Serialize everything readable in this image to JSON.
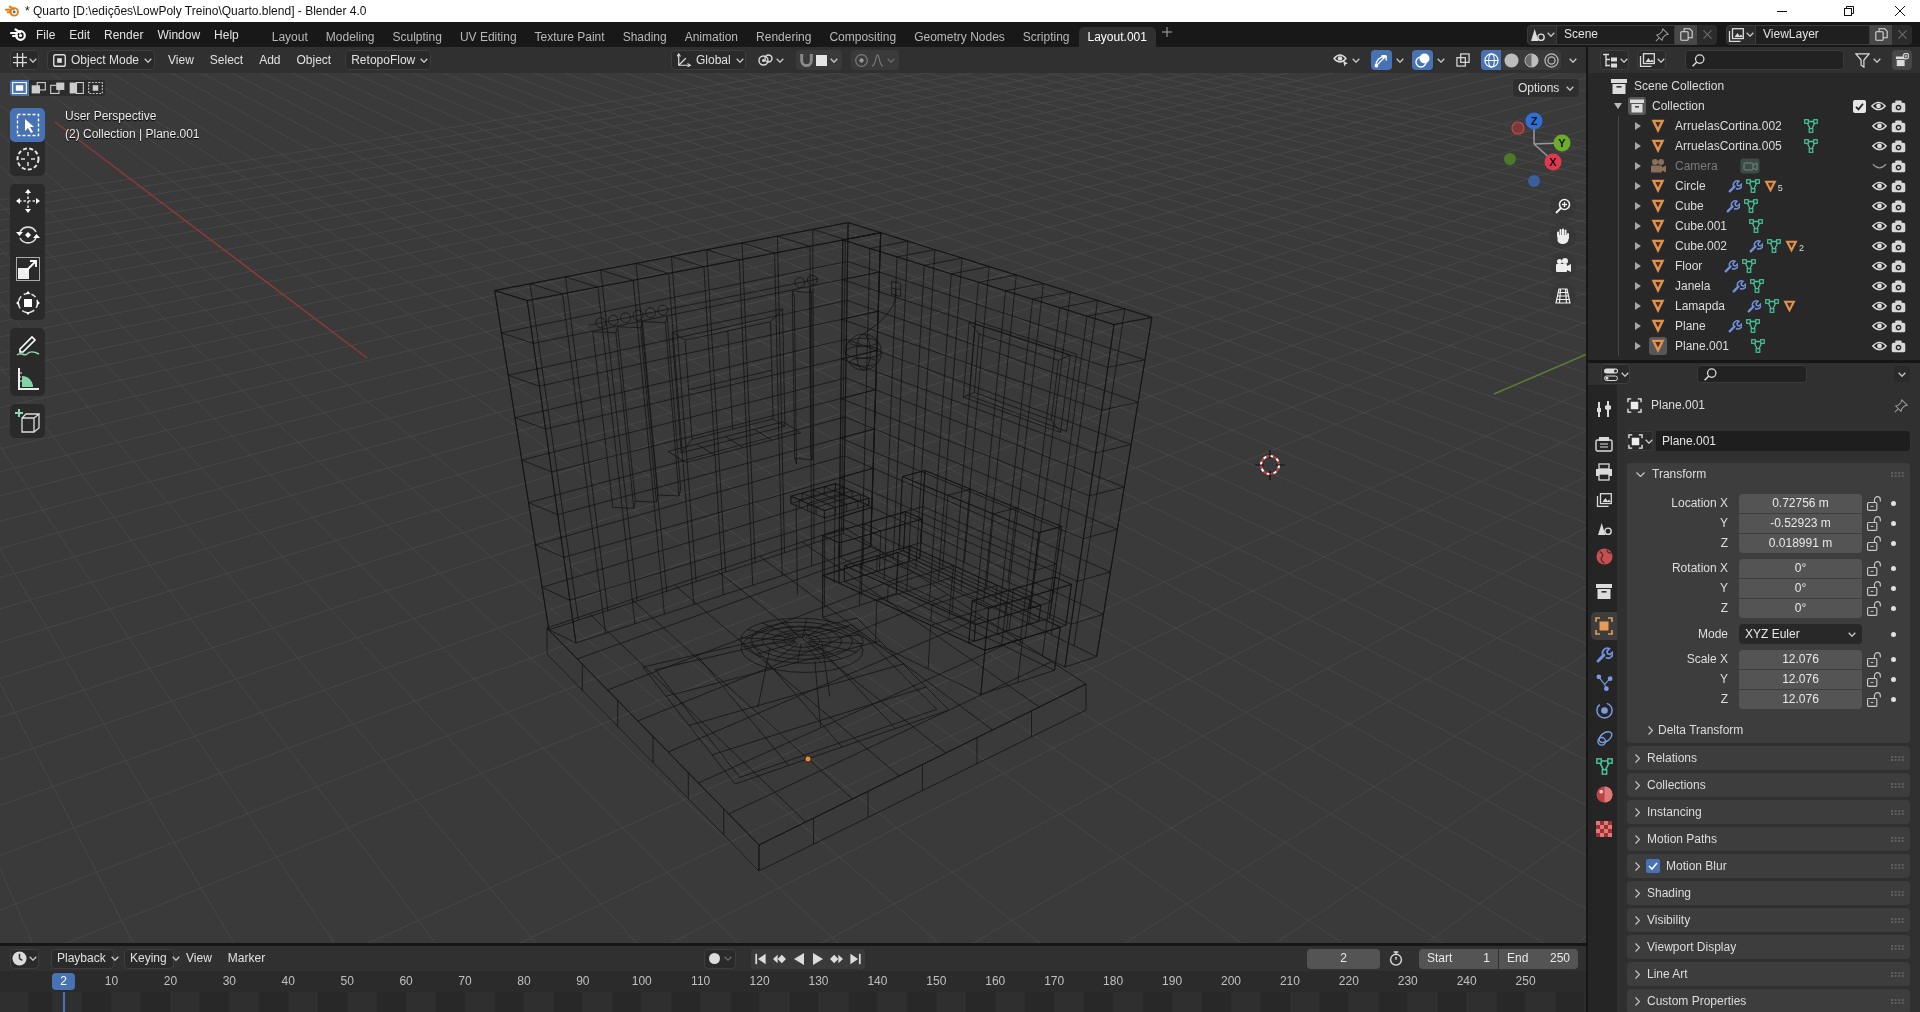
{
  "window": {
    "title": "* Quarto [D:\\edições\\LowPoly Treino\\Quarto.blend] - Blender 4.0"
  },
  "menu": [
    "File",
    "Edit",
    "Render",
    "Window",
    "Help"
  ],
  "workspaces": [
    {
      "label": "Layout",
      "selected": false
    },
    {
      "label": "Modeling",
      "selected": false
    },
    {
      "label": "Sculpting",
      "selected": false
    },
    {
      "label": "UV Editing",
      "selected": false
    },
    {
      "label": "Texture Paint",
      "selected": false
    },
    {
      "label": "Shading",
      "selected": false
    },
    {
      "label": "Animation",
      "selected": false
    },
    {
      "label": "Rendering",
      "selected": false
    },
    {
      "label": "Compositing",
      "selected": false
    },
    {
      "label": "Geometry Nodes",
      "selected": false
    },
    {
      "label": "Scripting",
      "selected": false
    },
    {
      "label": "Layout.001",
      "selected": true
    }
  ],
  "scene": {
    "name": "Scene"
  },
  "view_layer": {
    "name": "ViewLayer"
  },
  "viewport": {
    "mode": "Object Mode",
    "menus": [
      "View",
      "Select",
      "Add",
      "Object"
    ],
    "addon_menu": "RetopoFlow",
    "orientation": "Global",
    "gizmos_on": true,
    "overlays_on": true,
    "xray_on": false,
    "shading": [
      {
        "kind": "wireframe",
        "selected": true
      },
      {
        "kind": "solid",
        "selected": false
      },
      {
        "kind": "material",
        "selected": false
      },
      {
        "kind": "rendered",
        "selected": false
      }
    ],
    "select_modes": [
      {
        "kind": "set",
        "selected": true
      },
      {
        "kind": "extend",
        "selected": false
      },
      {
        "kind": "subtract",
        "selected": false
      },
      {
        "kind": "invert",
        "selected": false
      },
      {
        "kind": "intersect",
        "selected": false
      }
    ],
    "options": "Options",
    "info": [
      "User Perspective",
      "(2) Collection | Plane.001"
    ],
    "tool_groups": [
      [
        {
          "kind": "select_box",
          "selected": true
        },
        {
          "kind": "cursor",
          "selected": false
        }
      ],
      [
        {
          "kind": "move",
          "selected": false
        },
        {
          "kind": "rotate",
          "selected": false
        },
        {
          "kind": "scale",
          "selected": false
        },
        {
          "kind": "transform",
          "selected": false
        }
      ],
      [
        {
          "kind": "annotate",
          "selected": false
        },
        {
          "kind": "measure",
          "selected": false
        }
      ],
      [
        {
          "kind": "add_cube",
          "selected": false
        }
      ]
    ],
    "gizmo_axes": [
      "X",
      "Y",
      "Z"
    ]
  },
  "outliner": {
    "root": "Scene Collection",
    "collection": {
      "name": "Collection",
      "selected": true,
      "expanded": true,
      "checked": true,
      "visible": true,
      "children": [
        {
          "name": "ArruelasCortina.002",
          "kind": "mesh",
          "selected": false,
          "expanded": false,
          "visible": true,
          "badges": [
            {
              "kind": "mesh"
            }
          ]
        },
        {
          "name": "ArruelasCortina.005",
          "kind": "mesh",
          "selected": false,
          "expanded": false,
          "visible": true,
          "badges": [
            {
              "kind": "mesh"
            }
          ]
        },
        {
          "name": "Camera",
          "kind": "camera",
          "selected": false,
          "expanded": false,
          "visible": false,
          "badges": [
            {
              "kind": "camera"
            }
          ]
        },
        {
          "name": "Circle",
          "kind": "mesh",
          "selected": false,
          "expanded": false,
          "visible": true,
          "badges": [
            {
              "kind": "modifier"
            },
            {
              "kind": "mesh"
            },
            {
              "kind": "object",
              "count": "5"
            }
          ]
        },
        {
          "name": "Cube",
          "kind": "mesh",
          "selected": false,
          "expanded": false,
          "visible": true,
          "badges": [
            {
              "kind": "modifier"
            },
            {
              "kind": "mesh"
            }
          ]
        },
        {
          "name": "Cube.001",
          "kind": "mesh",
          "selected": false,
          "expanded": false,
          "visible": true,
          "badges": [
            {
              "kind": "mesh"
            }
          ]
        },
        {
          "name": "Cube.002",
          "kind": "mesh",
          "selected": false,
          "expanded": false,
          "visible": true,
          "badges": [
            {
              "kind": "modifier"
            },
            {
              "kind": "mesh"
            },
            {
              "kind": "object",
              "count": "2"
            }
          ]
        },
        {
          "name": "Floor",
          "kind": "mesh",
          "selected": false,
          "expanded": false,
          "visible": true,
          "badges": [
            {
              "kind": "modifier"
            },
            {
              "kind": "mesh"
            }
          ]
        },
        {
          "name": "Janela",
          "kind": "mesh",
          "selected": false,
          "expanded": false,
          "visible": true,
          "badges": [
            {
              "kind": "modifier"
            },
            {
              "kind": "mesh"
            }
          ]
        },
        {
          "name": "Lamapda",
          "kind": "mesh",
          "selected": false,
          "expanded": false,
          "visible": true,
          "badges": [
            {
              "kind": "modifier"
            },
            {
              "kind": "mesh"
            },
            {
              "kind": "object"
            }
          ]
        },
        {
          "name": "Plane",
          "kind": "mesh",
          "selected": false,
          "expanded": false,
          "visible": true,
          "badges": [
            {
              "kind": "modifier"
            },
            {
              "kind": "mesh"
            }
          ]
        },
        {
          "name": "Plane.001",
          "kind": "mesh",
          "selected": true,
          "expanded": false,
          "visible": true,
          "badges": [
            {
              "kind": "mesh"
            }
          ]
        }
      ]
    }
  },
  "properties": {
    "tab_groups": [
      [
        {
          "kind": "tool",
          "selected": false
        }
      ],
      [
        {
          "kind": "render",
          "selected": false
        },
        {
          "kind": "output",
          "selected": false
        },
        {
          "kind": "view_layer",
          "selected": false
        },
        {
          "kind": "scene",
          "selected": false
        },
        {
          "kind": "world",
          "selected": false
        }
      ],
      [
        {
          "kind": "collection",
          "selected": false
        }
      ],
      [
        {
          "kind": "object",
          "selected": true
        },
        {
          "kind": "modifiers",
          "selected": false
        },
        {
          "kind": "particles",
          "selected": false
        },
        {
          "kind": "physics",
          "selected": false
        },
        {
          "kind": "constraints",
          "selected": false
        },
        {
          "kind": "data",
          "selected": false
        },
        {
          "kind": "material",
          "selected": false
        }
      ],
      [
        {
          "kind": "texture",
          "selected": false
        }
      ]
    ],
    "object_name": "Plane.001",
    "datablock": "Plane.001",
    "transform": {
      "title": "Transform",
      "expanded": true,
      "groups": [
        {
          "kind": "number",
          "rows": [
            {
              "label": "Location X",
              "value": "0.72756 m",
              "locked": false
            },
            {
              "label": "Y",
              "value": "-0.52923 m",
              "locked": false
            },
            {
              "label": "Z",
              "value": "0.018991 m",
              "locked": false
            }
          ]
        },
        {
          "kind": "number",
          "rows": [
            {
              "label": "Rotation X",
              "value": "0°",
              "locked": false
            },
            {
              "label": "Y",
              "value": "0°",
              "locked": false
            },
            {
              "label": "Z",
              "value": "0°",
              "locked": false
            }
          ]
        },
        {
          "kind": "dropdown",
          "rows": [
            {
              "label": "Mode",
              "value": "XYZ Euler"
            }
          ]
        },
        {
          "kind": "number",
          "rows": [
            {
              "label": "Scale X",
              "value": "12.076",
              "locked": false
            },
            {
              "label": "Y",
              "value": "12.076",
              "locked": false
            },
            {
              "label": "Z",
              "value": "12.076",
              "locked": false
            }
          ]
        }
      ],
      "subpanels": [
        {
          "title": "Delta Transform",
          "expanded": false
        }
      ]
    },
    "panels": [
      {
        "title": "Relations",
        "kind": "plain",
        "expanded": false
      },
      {
        "title": "Collections",
        "kind": "plain",
        "expanded": false
      },
      {
        "title": "Instancing",
        "kind": "plain",
        "expanded": false
      },
      {
        "title": "Motion Paths",
        "kind": "plain",
        "expanded": false
      },
      {
        "title": "Motion Blur",
        "kind": "checkbox",
        "checked": true,
        "expanded": false
      },
      {
        "title": "Shading",
        "kind": "plain",
        "expanded": false
      },
      {
        "title": "Visibility",
        "kind": "plain",
        "expanded": false
      },
      {
        "title": "Viewport Display",
        "kind": "plain",
        "expanded": false
      },
      {
        "title": "Line Art",
        "kind": "plain",
        "expanded": false
      },
      {
        "title": "Custom Properties",
        "kind": "plain",
        "expanded": false
      }
    ]
  },
  "timeline": {
    "menus": [
      "Playback",
      "Keying",
      "View",
      "Marker"
    ],
    "current_frame": "2",
    "start_label": "Start",
    "start": "1",
    "end_label": "End",
    "end": "250",
    "playhead": "2",
    "ruler": [
      "10",
      "20",
      "30",
      "40",
      "50",
      "60",
      "70",
      "80",
      "90",
      "100",
      "110",
      "120",
      "130",
      "140",
      "150",
      "160",
      "170",
      "180",
      "190",
      "200",
      "210",
      "220",
      "230",
      "240",
      "250"
    ]
  }
}
